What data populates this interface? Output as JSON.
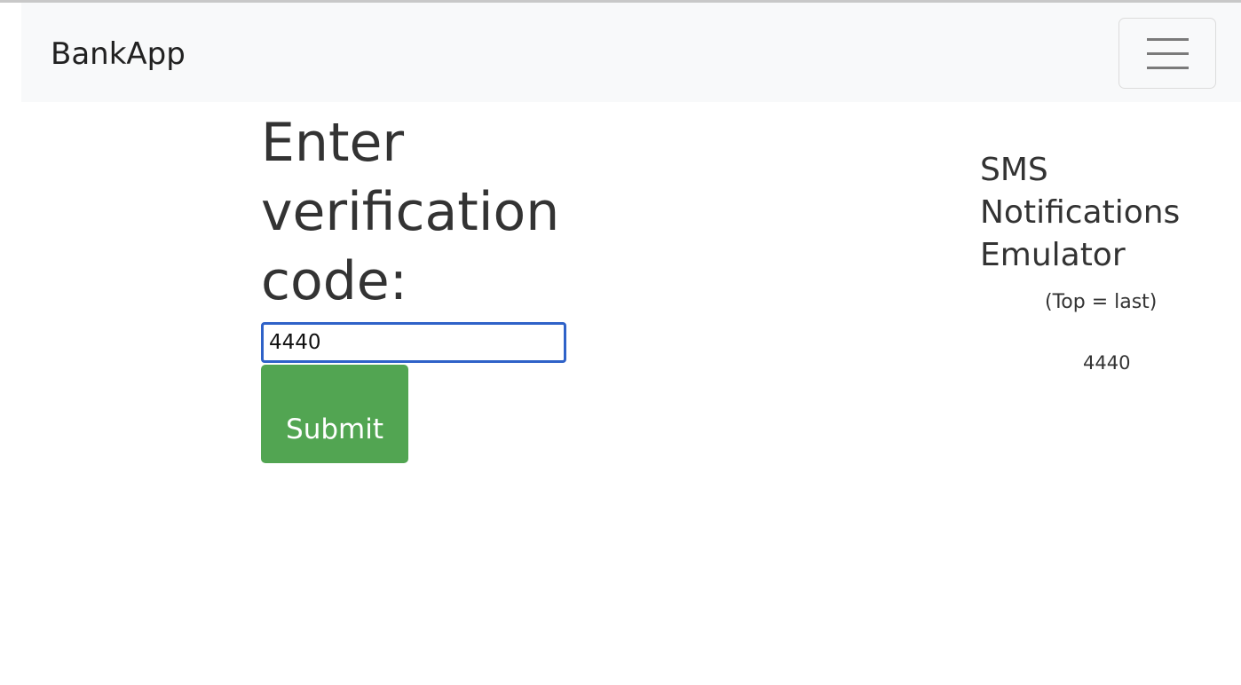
{
  "navbar": {
    "brand": "BankApp",
    "menu_icon": "hamburger-icon"
  },
  "form": {
    "heading": "Enter verification code:",
    "code_value": "4440",
    "submit_label": "Submit",
    "submit_color": "#52a552"
  },
  "sms": {
    "title": "SMS Notifications Emulator",
    "subtitle": "(Top = last)",
    "messages": [
      "4440"
    ]
  }
}
